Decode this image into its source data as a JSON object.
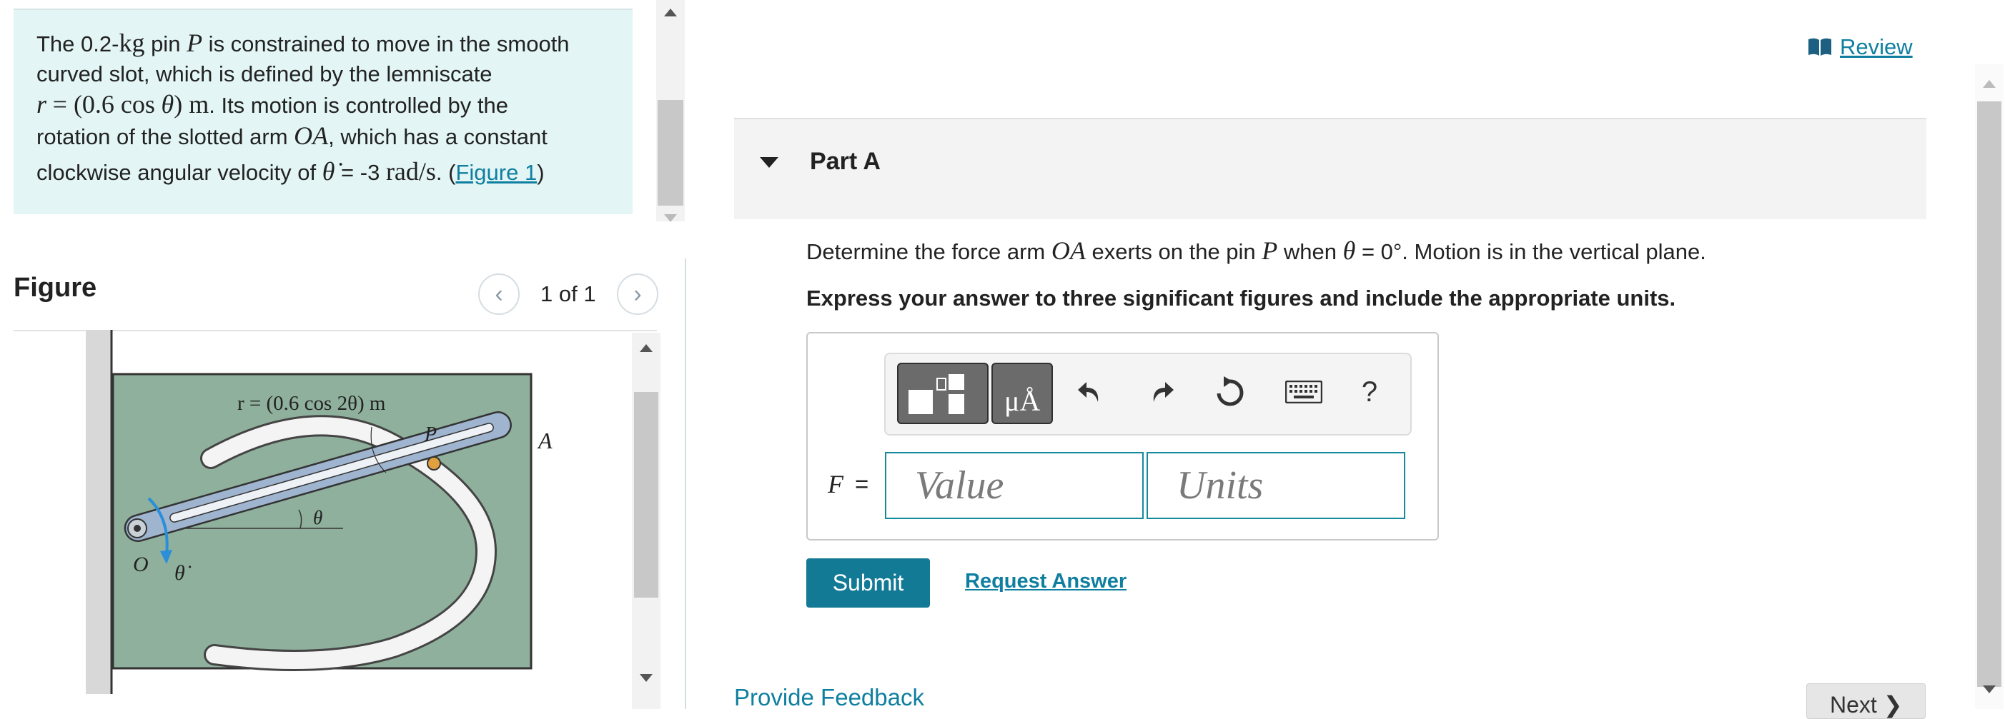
{
  "problem": {
    "line1": "The 0.2-kg pin P is constrained to move in the smooth",
    "line2": "curved slot, which is defined by the lemniscate",
    "line3": "r = (0.6 cos θ) m. Its motion is controlled by the",
    "line4": "rotation of the slotted arm OA, which has a constant",
    "line5_prefix": "clockwise angular velocity of θ̇ = -3 rad/s. (",
    "figure_link": "Figure 1",
    "line5_suffix": ")"
  },
  "figure": {
    "title": "Figure",
    "pager": "1 of 1",
    "prev_icon": "chevron-left-icon",
    "next_icon": "chevron-right-icon",
    "diagram_label_equation": "r = (0.6 cos 2θ) m",
    "diagram_label_p": "P",
    "diagram_label_a": "A",
    "diagram_label_o": "O",
    "diagram_label_theta": "θ",
    "diagram_label_thetadot": "θ̇"
  },
  "review": {
    "label": "Review",
    "icon": "book-icon"
  },
  "part_a": {
    "title": "Part A",
    "question": "Determine the force arm OA exerts on the pin P when θ = 0°. Motion is in the vertical plane.",
    "instruction": "Express your answer to three significant figures and include the appropriate units."
  },
  "answer": {
    "variable": "F",
    "equals": "=",
    "value_placeholder": "Value",
    "units_placeholder": "Units",
    "toolbar_icons": [
      "templates-icon",
      "units-icon",
      "undo-icon",
      "redo-icon",
      "reset-icon",
      "keyboard-icon",
      "help-icon"
    ],
    "units_button_text": "μÅ",
    "help_text": "?"
  },
  "actions": {
    "submit": "Submit",
    "request_answer": "Request Answer",
    "feedback": "Provide Feedback",
    "next": "Next ❯"
  },
  "colors": {
    "problem_bg": "#e3f5f5",
    "link": "#0f7fa0",
    "submit_bg": "#137a96",
    "input_border": "#148a9c",
    "plate_fill": "#8fb09c",
    "arm_fill": "#9eb4cf"
  }
}
